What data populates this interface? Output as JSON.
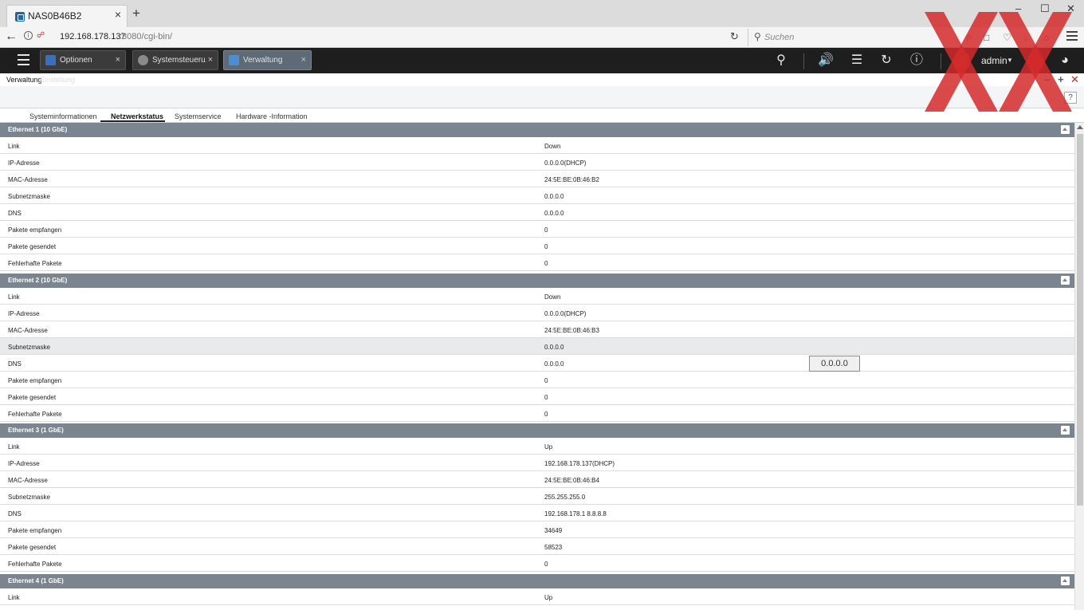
{
  "browser": {
    "tab_title": "NAS0B46B2",
    "tab_close": "×",
    "new_tab": "+",
    "url_host": "192.168.178.137",
    "url_rest": ":8080/cgi-bin/",
    "search_placeholder": "Suchen",
    "min": "–",
    "max": "☐",
    "close": "✕"
  },
  "qts": {
    "tabs": [
      {
        "label": "Optionen",
        "close": "×"
      },
      {
        "label": "Systemsteueru...",
        "close": "×"
      },
      {
        "label": "Verwaltung",
        "close": "×"
      }
    ],
    "user": "admin"
  },
  "window": {
    "title": "Verwaltung",
    "subtitle": "Einstellung",
    "help": "?"
  },
  "subtabs": [
    "Systeminformationen",
    "Netzwerkstatus",
    "Systemservice",
    "Hardware -Information"
  ],
  "sections": [
    {
      "title": "Ethernet 1 (10 GbE)",
      "rows": [
        {
          "key": "Link",
          "value": "Down"
        },
        {
          "key": "IP-Adresse",
          "value": "0.0.0.0(DHCP)"
        },
        {
          "key": "MAC-Adresse",
          "value": "24:5E:BE:0B:46:B2"
        },
        {
          "key": "Subnetzmaske",
          "value": "0.0.0.0"
        },
        {
          "key": "DNS",
          "value": "0.0.0.0"
        },
        {
          "key": "Pakete empfangen",
          "value": "0"
        },
        {
          "key": "Pakete gesendet",
          "value": "0"
        },
        {
          "key": "Fehlerhafte Pakete",
          "value": "0"
        }
      ]
    },
    {
      "title": "Ethernet 2 (10 GbE)",
      "rows": [
        {
          "key": "Link",
          "value": "Down"
        },
        {
          "key": "IP-Adresse",
          "value": "0.0.0.0(DHCP)"
        },
        {
          "key": "MAC-Adresse",
          "value": "24:5E:BE:0B:46:B3"
        },
        {
          "key": "Subnetzmaske",
          "value": "0.0.0.0"
        },
        {
          "key": "DNS",
          "value": "0.0.0.0"
        },
        {
          "key": "Pakete empfangen",
          "value": "0"
        },
        {
          "key": "Pakete gesendet",
          "value": "0"
        },
        {
          "key": "Fehlerhafte Pakete",
          "value": "0"
        }
      ]
    },
    {
      "title": "Ethernet 3 (1 GbE)",
      "rows": [
        {
          "key": "Link",
          "value": "Up"
        },
        {
          "key": "IP-Adresse",
          "value": "192.168.178.137(DHCP)"
        },
        {
          "key": "MAC-Adresse",
          "value": "24:5E:BE:0B:46:B4"
        },
        {
          "key": "Subnetzmaske",
          "value": "255.255.255.0"
        },
        {
          "key": "DNS",
          "value": "192.168.178.1 8.8.8.8"
        },
        {
          "key": "Pakete empfangen",
          "value": "34649"
        },
        {
          "key": "Pakete gesendet",
          "value": "58523"
        },
        {
          "key": "Fehlerhafte Pakete",
          "value": "0"
        }
      ]
    },
    {
      "title": "Ethernet 4 (1 GbE)",
      "rows": [
        {
          "key": "Link",
          "value": "Up"
        }
      ]
    }
  ],
  "tooltip": "0.0.0.0",
  "colors": {
    "section_header": "#7b8590",
    "qts_bar": "#1e1e1e",
    "watermark": "#d42a2a"
  }
}
